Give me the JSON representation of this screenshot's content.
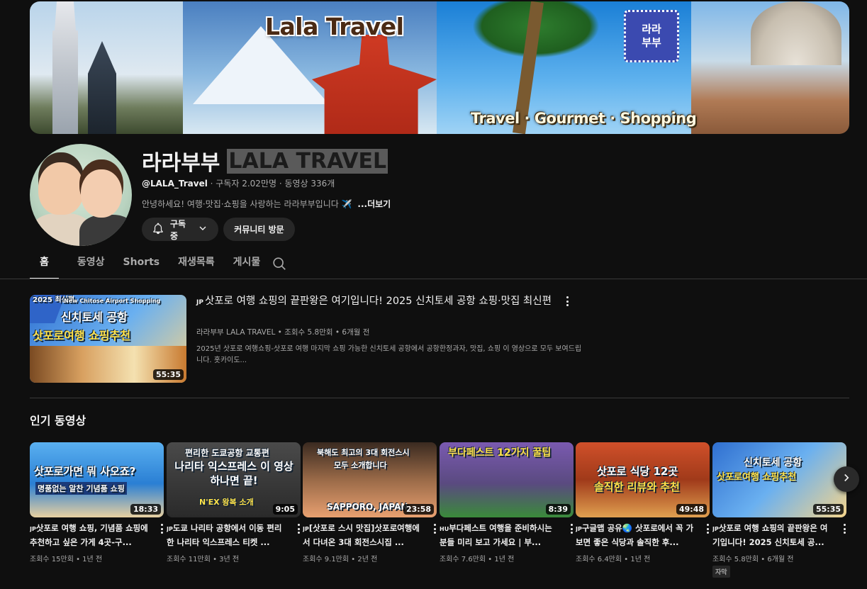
{
  "banner": {
    "title": "Lala Travel",
    "tagline": "Travel · Gourmet · Shopping",
    "logo_top": "라라",
    "logo_bottom": "부부"
  },
  "channel": {
    "name": "라라부부",
    "name_en": "LALA TRAVEL",
    "handle": "@LALA_Travel",
    "stats": "· 구독자 2.02만명 · 동영상 336개",
    "description": "안녕하세요! 여행·맛집·쇼핑을 사랑하는 라라부부입니다 ✈️",
    "more": "...더보기",
    "subscribe_label": "구독중",
    "community_label": "커뮤니티 방문"
  },
  "tabs": [
    {
      "label": "홈"
    },
    {
      "label": "동영상"
    },
    {
      "label": "Shorts"
    },
    {
      "label": "재생목록"
    },
    {
      "label": "게시물"
    }
  ],
  "featured": {
    "flag": "JP",
    "title": "삿포로 여행 쇼핑의 끝판왕은 여기입니다! 2025 신치토세 공항 쇼핑·맛집 최신편",
    "meta": "라라부부 LALA TRAVEL • 조회수 5.8만회 • 6개월 전",
    "description": "2025년 삿포로 여행쇼핑-삿포로 여행 마지막 쇼핑 가능한 신치토세 공항에서 공항한정과자, 맛집, 쇼핑 이 영상으로 모두 보여드립니다. 홋카이도...",
    "duration": "55:35",
    "thumb_top": "New Chitose Airport Shopping",
    "thumb_line1": "신치토세 공항",
    "thumb_line2": "삿포로여행 쇼핑추천",
    "thumb_badge": "2025 최신편"
  },
  "popular": {
    "section_title": "인기 동영상",
    "videos": [
      {
        "flag": "JP",
        "title": "삿포로 여행 쇼핑, 기념품 쇼핑에 추천하고 싶은 가게 4곳-구...",
        "meta": "조회수 15만회 • 1년 전",
        "duration": "18:33",
        "thumb_a": "삿포로가면 뭐 사오죠?",
        "thumb_b": "명품없는 알찬 기념품 쇼핑",
        "bg": "#4aa0e6"
      },
      {
        "flag": "JP",
        "title": "도쿄 나리타 공항에서 이동 편리한 나리타 익스프레스 티켓 ...",
        "meta": "조회수 11만회 • 3년 전",
        "duration": "9:05",
        "thumb_a": "편리한 도쿄공항 교통편",
        "thumb_b": "나리타 익스프레스 이 영상 하나면 끝!",
        "thumb_c": "N'EX 왕복 소개",
        "bg": "#3a3a3a"
      },
      {
        "flag": "JP",
        "title": "[삿포로 스시 맛집]삿포로여행에서 다녀온 3대 회전스시집 ...",
        "meta": "조회수 9.1만회 • 2년 전",
        "duration": "23:58",
        "thumb_a": "북해도 최고의 3대 회전스시",
        "thumb_b": "모두 소개합니다",
        "thumb_c": "SAPPORO, JAPAN",
        "bg": "#8a6a4a"
      },
      {
        "flag": "HU",
        "title": "부다페스트 여행을 준비하시는 분들 미리 보고 가세요 | 부...",
        "meta": "조회수 7.6만회 • 1년 전",
        "duration": "8:39",
        "thumb_a": "부다페스트 12가지 꿀팁",
        "bg": "#5e4a8a"
      },
      {
        "flag": "JP",
        "title": "구글맵 공유🌏 삿포로에서 꼭 가보면 좋은 식당과 솔직한 후...",
        "meta": "조회수 6.4만회 • 1년 전",
        "duration": "49:48",
        "thumb_a": "삿포로 식당 12곳",
        "thumb_b": "솔직한 리뷰와 추천",
        "bg": "#c24a2a"
      },
      {
        "flag": "JP",
        "title": "삿포로 여행 쇼핑의 끝판왕은 여기입니다! 2025 신치토세 공...",
        "meta": "조회수 5.8만회 • 6개월 전",
        "duration": "55:35",
        "thumb_a": "신치토세 공항",
        "thumb_b": "삿포로여행 쇼핑추천",
        "badge": "자막",
        "bg": "#3a82d8"
      }
    ]
  },
  "icons": {
    "bell": "bell-icon",
    "chevron": "chevron-down-icon",
    "search": "search-icon",
    "more": "more-vert-icon",
    "next": "chevron-right-icon"
  }
}
